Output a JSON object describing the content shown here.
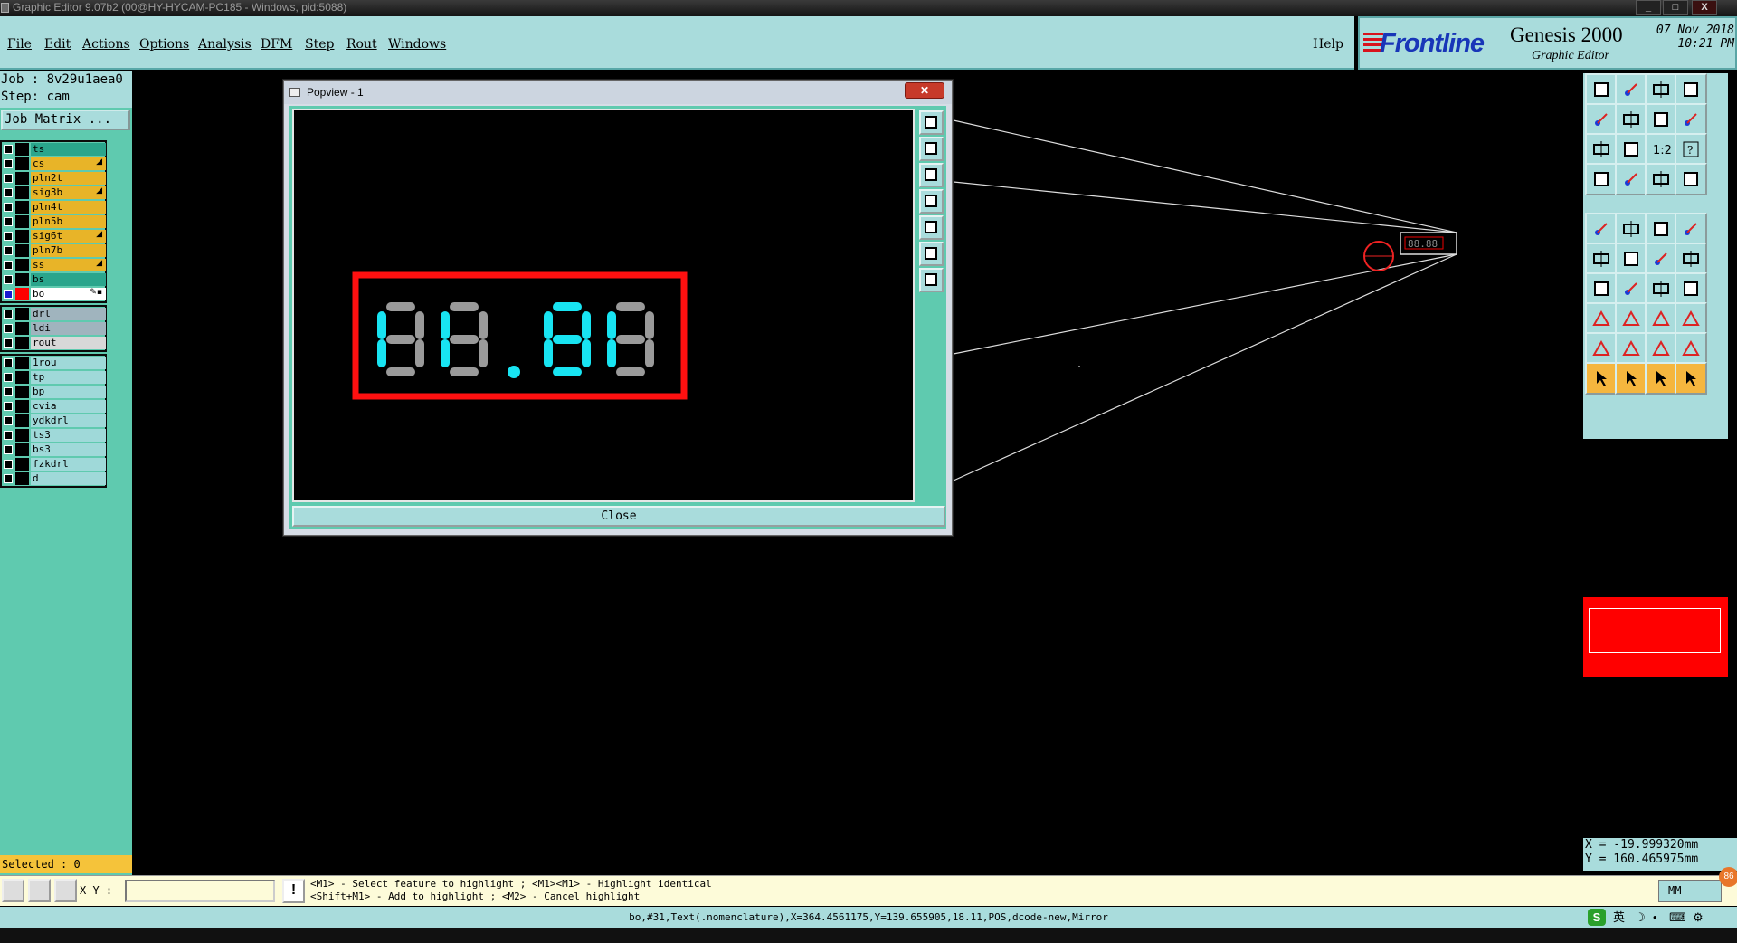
{
  "window": {
    "title": "Graphic Editor 9.07b2 (00@HY-HYCAM-PC185 - Windows, pid:5088)",
    "min": "_",
    "max": "□",
    "close": "X"
  },
  "menu": [
    "File",
    "Edit",
    "Actions",
    "Options",
    "Analysis",
    "DFM",
    "Step",
    "Rout",
    "Windows"
  ],
  "help": "Help",
  "brand": {
    "logo": "Frontline",
    "product": "Genesis 2000",
    "subtitle": "Graphic Editor",
    "date": "07 Nov 2018",
    "time": "10:21 PM"
  },
  "job": {
    "job_line": "Job : 8v29u1aea0",
    "step_line": "Step: cam",
    "matrix_button": "Job Matrix ..."
  },
  "layers_group1": [
    {
      "name": "ts",
      "color": "#2aa58c",
      "mark": ""
    },
    {
      "name": "cs",
      "color": "#e8b428",
      "mark": "◢"
    },
    {
      "name": "pln2t",
      "color": "#e8b428",
      "mark": ""
    },
    {
      "name": "sig3b",
      "color": "#e8b428",
      "mark": "◢"
    },
    {
      "name": "pln4t",
      "color": "#e8b428",
      "mark": ""
    },
    {
      "name": "pln5b",
      "color": "#e8b428",
      "mark": ""
    },
    {
      "name": "sig6t",
      "color": "#e8b428",
      "mark": "◢"
    },
    {
      "name": "pln7b",
      "color": "#e8b428",
      "mark": ""
    },
    {
      "name": "ss",
      "color": "#e8b428",
      "mark": "◢"
    },
    {
      "name": "bs",
      "color": "#2aa58c",
      "mark": ""
    },
    {
      "name": "bo",
      "color": "#ffffff",
      "mark": "✎▪",
      "active": true
    }
  ],
  "layers_group2": [
    {
      "name": "drl",
      "color": "#a0b4be",
      "mark": ""
    },
    {
      "name": "ldi",
      "color": "#a0b4be",
      "mark": ""
    },
    {
      "name": "rout",
      "color": "#d8d8d8",
      "mark": ""
    }
  ],
  "layers_group3": [
    {
      "name": "1rou",
      "color": "#9fd9d9",
      "mark": ""
    },
    {
      "name": "tp",
      "color": "#9fd9d9",
      "mark": ""
    },
    {
      "name": "bp",
      "color": "#9fd9d9",
      "mark": ""
    },
    {
      "name": "cvia",
      "color": "#9fd9d9",
      "mark": ""
    },
    {
      "name": "ydkdrl",
      "color": "#9fd9d9",
      "mark": ""
    },
    {
      "name": "ts3",
      "color": "#9fd9d9",
      "mark": ""
    },
    {
      "name": "bs3",
      "color": "#9fd9d9",
      "mark": ""
    },
    {
      "name": "fzkdrl",
      "color": "#9fd9d9",
      "mark": ""
    },
    {
      "name": "d",
      "color": "#9fd9d9",
      "mark": ""
    }
  ],
  "selected": "Selected : 0",
  "popup": {
    "title": "Popview - 1",
    "close_label": "Close",
    "display_text": "88.88"
  },
  "canvas_label": "88.88",
  "tools": {
    "ratio_label": "1:2",
    "help_label": "?"
  },
  "coords": {
    "x": "X = -19.999320mm",
    "y": "Y = 160.465975mm"
  },
  "command": {
    "xy_label": "X Y :",
    "xy_value": "",
    "warn": "!",
    "hint1": "<M1> - Select feature to highlight ; <M1><M1> - Highlight identical",
    "hint2": "<Shift+M1> - Add to highlight ; <M2> - Cancel highlight",
    "unit": "MM"
  },
  "status": "bo,#31,Text(.nomenclature),X=364.4561175,Y=139.655905,18.11,POS,dcode-new,Mirror",
  "tray": {
    "ime": "英",
    "badge": "86"
  }
}
